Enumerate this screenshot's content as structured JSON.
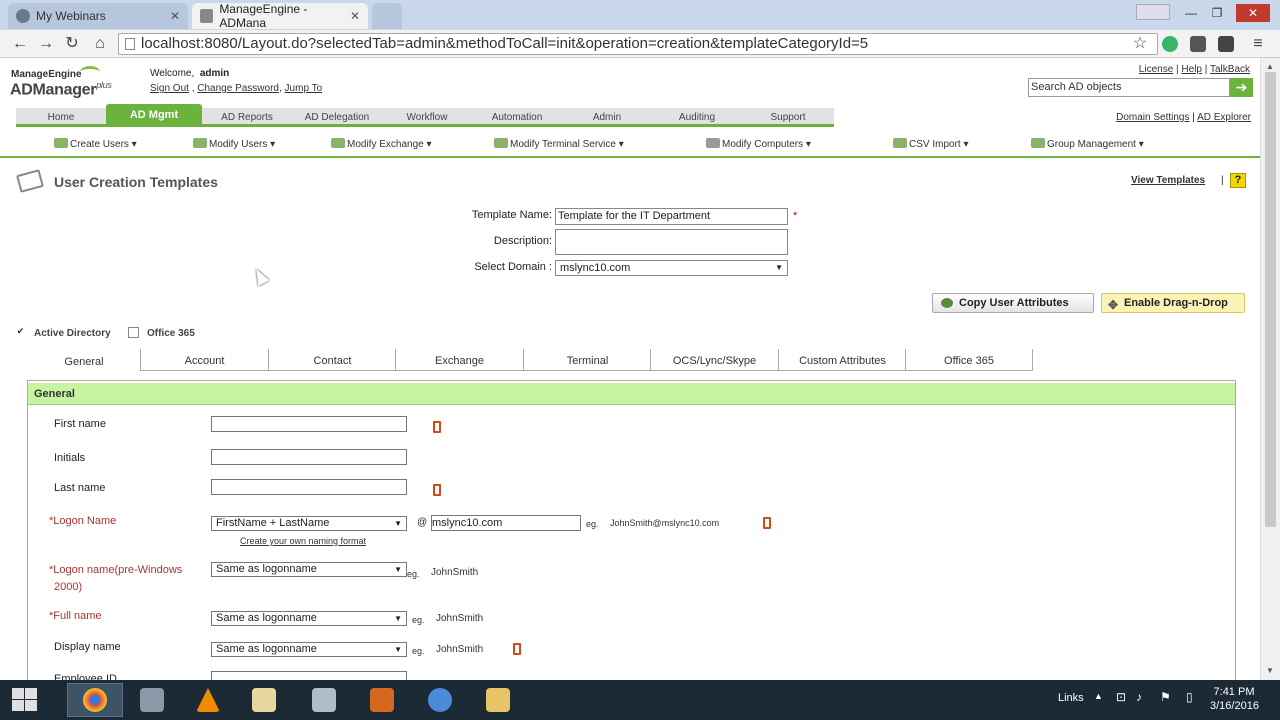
{
  "browser": {
    "tabs": [
      {
        "title": "My Webinars",
        "active": false
      },
      {
        "title": "ManageEngine - ADMana",
        "active": true
      },
      {
        "title": "",
        "active": false
      }
    ],
    "user_badge": "",
    "url": "localhost:8080/Layout.do?selectedTab=admin&methodToCall=init&operation=creation&templateCategoryId=5",
    "icons": [
      "back-icon",
      "forward-icon",
      "reload-icon",
      "home-icon",
      "star-icon"
    ]
  },
  "app": {
    "logo_top": "ManageEngine",
    "logo_main": "ADManager",
    "logo_plus": "plus",
    "welcome_label": "Welcome,",
    "username": "admin",
    "sign_out": "Sign Out",
    "change_password": "Change Password",
    "jump_to": "Jump To",
    "top_links": {
      "license": "License",
      "help": "Help",
      "talkback": "TalkBack"
    },
    "search_placeholder": "Search AD objects",
    "main_tabs": [
      "Home",
      "AD Mgmt",
      "AD Reports",
      "AD Delegation",
      "Workflow",
      "Automation",
      "Admin",
      "Auditing",
      "Support"
    ],
    "active_main_tab": "AD Mgmt",
    "domain_settings": "Domain Settings",
    "ad_explorer": "AD Explorer",
    "sub_menu": [
      "Create Users",
      "Modify Users",
      "Modify Exchange",
      "Modify Terminal Service",
      "Modify Computers",
      "CSV Import",
      "Group Management"
    ]
  },
  "page": {
    "title": "User Creation Templates",
    "view_templates": "View Templates",
    "help": "?",
    "template_name_label": "Template Name:",
    "template_name_value": "Template for the IT Department",
    "description_label": "Description:",
    "description_value": "",
    "domain_label": "Select Domain :",
    "domain_value": "mslync10.com",
    "required_mark": "*",
    "copy_attributes": "Copy User Attributes",
    "enable_dnd": "Enable Drag-n-Drop",
    "active_directory": "Active Directory",
    "office365_check": "Office 365",
    "form_tabs": [
      "General",
      "Account",
      "Contact",
      "Exchange",
      "Terminal",
      "OCS/Lync/Skype",
      "Custom Attributes",
      "Office 365"
    ],
    "active_form_tab": "General",
    "section_title": "General"
  },
  "general": {
    "first_name": "First name",
    "initials": "Initials",
    "last_name": "Last name",
    "logon_name": "Logon Name",
    "logon_format": "FirstName + LastName",
    "at": "@",
    "logon_domain": "mslync10.com",
    "eg": "eg.",
    "logon_example": "JohnSmith@mslync10.com",
    "naming_link": "Create your own naming format",
    "pre2000_line1": "Logon name(pre-Windows",
    "pre2000_line2": "2000)",
    "pre2000_value": "Same as logonname",
    "pre2000_example": "JohnSmith",
    "full_name": "Full name",
    "full_name_value": "Same as logonname",
    "full_name_example": "JohnSmith",
    "display_name": "Display name",
    "display_name_value": "Same as logonname",
    "display_name_example": "JohnSmith",
    "employee_id": "Employee ID"
  },
  "taskbar": {
    "tray_links": "Links",
    "time": "7:41 PM",
    "date": "3/16/2016"
  },
  "colors": {
    "accent_green": "#6cb33e",
    "panel_header": "#c8f3a0",
    "required_red": "#a33"
  }
}
